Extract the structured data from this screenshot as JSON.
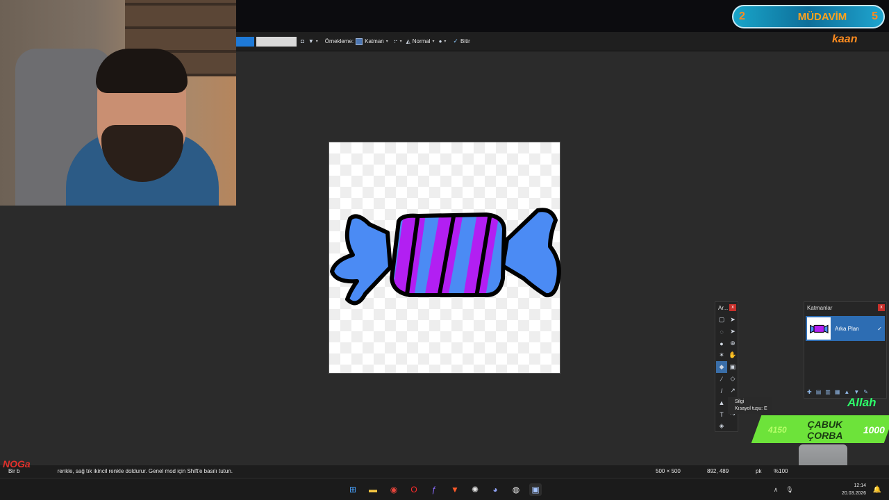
{
  "toolbar": {
    "sampling_label": "Örnekleme:",
    "sampling_value": "Katman",
    "blend_mode": "Normal",
    "finish_label": "Bitir",
    "colors": {
      "primary": "#1e7ad8",
      "secondary": "#d9d9d9"
    }
  },
  "tools_panel": {
    "title": "Ar...",
    "close": "x"
  },
  "tooltip": {
    "name": "Silgi",
    "shortcut": "Kısayol tuşu: E"
  },
  "layers_panel": {
    "title": "Katmanlar",
    "close": "x",
    "layers": [
      {
        "name": "Arka Plan",
        "visible": true
      }
    ]
  },
  "statusbar": {
    "hint_prefix": "Bir b",
    "hint": "renkle, sağ tık ikincil renkle doldurur. Genel mod için Shift'e basılı tutun.",
    "image_size": "500 × 500",
    "cursor_pos": "892, 489",
    "unit": "pk",
    "zoom": "%100"
  },
  "overlays": {
    "badge_level_left": "2",
    "badge_title": "MÜDAVİM",
    "badge_level_right": "5",
    "username": "kaan",
    "allah": "Allah",
    "reward_cost": "4150",
    "reward_title_1": "ÇABUK",
    "reward_title_2": "ÇORBA",
    "reward_value": "1000",
    "noga": "NOGa"
  },
  "taskbar": {
    "time": "12:14",
    "date": "20.03.2026",
    "apps": [
      "start",
      "file-explorer",
      "chrome",
      "opera",
      "fences",
      "brave",
      "chatgpt",
      "discord",
      "obs",
      "paint-net"
    ]
  }
}
